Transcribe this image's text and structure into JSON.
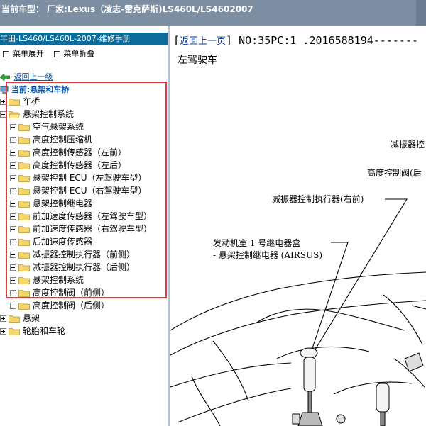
{
  "titlebar": {
    "text": "当前车型：  厂家:Lexus（凌志-雷克萨斯)LS460L/LS4602007"
  },
  "left": {
    "header": "丰田-LS460/LS460L-2007-维修手册",
    "toolbar": {
      "expand": "菜单展开",
      "collapse": "菜单折叠"
    },
    "back_link": "返回上一级",
    "current": "当前:悬架和车桥",
    "tree": [
      {
        "label": "车桥",
        "level": 1,
        "expanded": false
      },
      {
        "label": "悬架控制系统",
        "level": 1,
        "expanded": true
      },
      {
        "label": "空气悬架系统",
        "level": 2,
        "expanded": false
      },
      {
        "label": "高度控制压缩机",
        "level": 2,
        "expanded": false
      },
      {
        "label": "高度控制传感器（左前）",
        "level": 2,
        "expanded": false
      },
      {
        "label": "高度控制传感器（左后）",
        "level": 2,
        "expanded": false
      },
      {
        "label": "悬架控制 ECU（左驾驶车型）",
        "level": 2,
        "expanded": false
      },
      {
        "label": "悬架控制 ECU（右驾驶车型）",
        "level": 2,
        "expanded": false
      },
      {
        "label": "悬架控制继电器",
        "level": 2,
        "expanded": false
      },
      {
        "label": "前加速度传感器（左驾驶车型）",
        "level": 2,
        "expanded": false
      },
      {
        "label": "前加速度传感器（右驾驶车型）",
        "level": 2,
        "expanded": false
      },
      {
        "label": "后加速度传感器",
        "level": 2,
        "expanded": false
      },
      {
        "label": "减振器控制执行器（前侧）",
        "level": 2,
        "expanded": false
      },
      {
        "label": "减振器控制执行器（后侧）",
        "level": 2,
        "expanded": false
      },
      {
        "label": "悬架控制系统",
        "level": 2,
        "expanded": false
      },
      {
        "label": "高度控制阀（前侧）",
        "level": 2,
        "expanded": false
      },
      {
        "label": "高度控制阀（后侧）",
        "level": 2,
        "expanded": false
      },
      {
        "label": "悬架",
        "level": 1,
        "expanded": false
      },
      {
        "label": "轮胎和车轮",
        "level": 1,
        "expanded": false
      }
    ]
  },
  "right": {
    "back_link": "返回上一页",
    "doc_no": " NO:35PC:1 .2016588194-------",
    "subtitle": "左驾驶车",
    "labels": {
      "damper_cut": "减振器控",
      "height_valve_cut": "高度控制阀(后",
      "damper_front_right": "减振器控制执行器(右前)",
      "relay_box": "发动机室 1 号继电器盒",
      "relay_airsus": "- 悬架控制继电器 (AIRSUS)"
    }
  },
  "colors": {
    "titlebar": "#7d8ea3",
    "left_header": "#0b6b9a",
    "highlight": "#e23a3a",
    "link": "#0a58b0"
  }
}
